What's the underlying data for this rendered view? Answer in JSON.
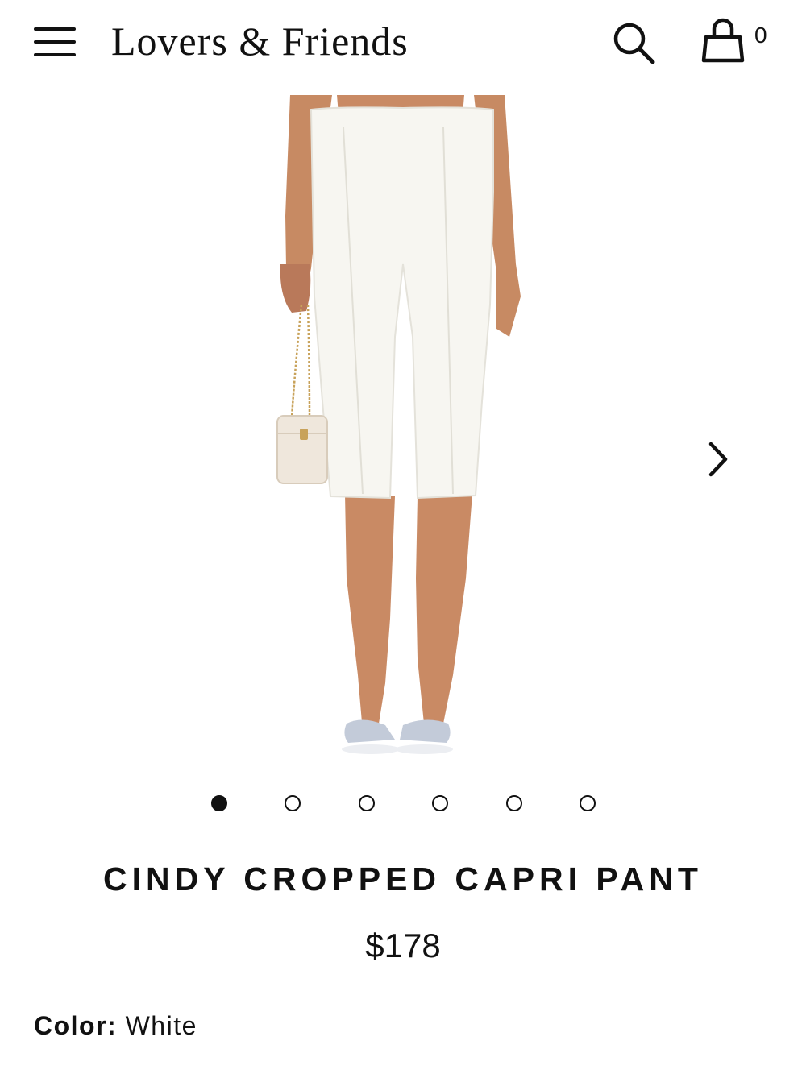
{
  "header": {
    "brand": "Lovers & Friends",
    "cart_count": "0"
  },
  "icons": {
    "menu": "hamburger-menu-icon",
    "search": "search-icon",
    "bag": "shopping-bag-icon",
    "next": "chevron-right-icon"
  },
  "gallery": {
    "image_count": 6,
    "active_index": 0
  },
  "product": {
    "title": "CINDY CROPPED CAPRI PANT",
    "price": "$178",
    "color_label": "Color:",
    "color_value": "White"
  },
  "colors": {
    "text": "#111111",
    "background": "#ffffff"
  }
}
